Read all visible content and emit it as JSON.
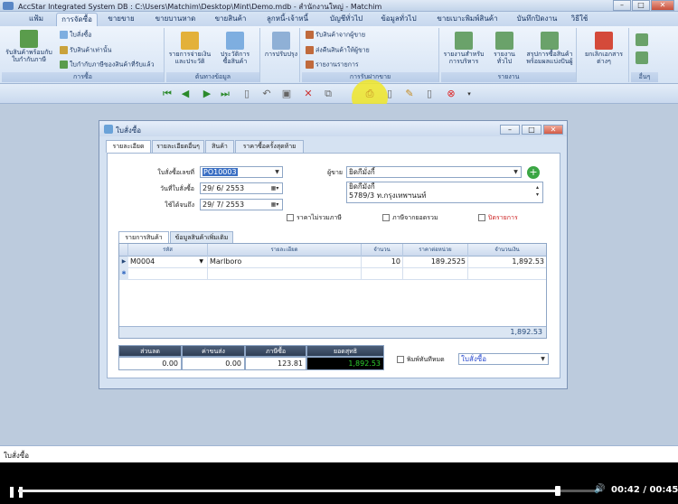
{
  "app": {
    "title": "AccStar Integrated System DB : C:\\Users\\Matchim\\Desktop\\Mint\\Demo.mdb - สำนักงานใหญ่ - Matchim"
  },
  "ribbon_tabs": [
    "แฟ้ม",
    "การจัดซื้อ",
    "ขายขาย",
    "ขายบานหาด",
    "ขายสินค้า",
    "ลูกหนี้-เจ้าหนี้",
    "บัญชีทั่วไป",
    "ข้อมูลทั่วไป",
    "ขายเบาะพิมพ์สินค้า",
    "บันทึกปิดงาน",
    "วิธีใช้"
  ],
  "active_tab_index": 1,
  "ribbon": {
    "groups": [
      {
        "label": "การซื้อ"
      },
      {
        "label": "ต้นทางข้อมูล"
      },
      {
        "label": ""
      },
      {
        "label": "การรับฝากขาย"
      },
      {
        "label": "รายงาน"
      },
      {
        "label": "อื่นๆ"
      }
    ],
    "buttons": {
      "receive_goods": "รับสินค้าพร้อมกับ\nใบกำกับภาษี",
      "purchase_order": "ใบสั่งซื้อ",
      "receive_goods_small": "รับสินค้าเท่านั้น",
      "tax_invoice": "ใบกำกับภาษีของสินค้าที่รับแล้ว",
      "po_report": "รายการจ่ายเงิน\nและประวัติ",
      "purchase_history": "ประวัติการ\nซื้อสินค้า",
      "adjust": "การปรับปรุง",
      "consign_receive": "รับสินค้าจากผู้ขาย",
      "consign_return": "ส่งคืนสินค้าให้ผู้ขาย",
      "consign_report": "รายงานรายการ",
      "report_1": "รายงานสำหรับ\nการบริหาร",
      "report_2": "รายงานทั่วไป",
      "report_3": "สรุปการซื้อสินค้า\nพร้อมผลแบ่งปันผู้",
      "cancel_doc": "ยกเลิกเอกสารต่างๆ"
    }
  },
  "child_window": {
    "title": "ใบสั่งซื้อ",
    "tabs": [
      "รายละเอียด",
      "รายละเอียดอื่นๆ",
      "สินค้า",
      "ราคาซื้อครั้งสุดท้าย"
    ],
    "active_tab_index": 0,
    "form": {
      "po_number_label": "ใบสั่งซื้อเลขที่",
      "po_number": "PO10003",
      "po_date_label": "วันที่ใบสั่งซื้อ",
      "po_date": "29/ 6/ 2553",
      "due_date_label": "ใช้ได้จนถึง",
      "due_date": "29/ 7/ 2553",
      "vendor_label": "ผู้ขาย",
      "vendor": "ยิดกีมั่งกี้",
      "vendor_address_line1": "ยิดกีมั่งกี้",
      "vendor_address_line2": "5789/3 ท.กรุงเทพฯนนท์",
      "checkbox_exclude_vat": "ราคาไม่รวมภาษี",
      "checkbox_no_discount": "ภาษีจากยอดรวม",
      "checkbox_cancelled": "ปิดรายการ"
    },
    "subtabs": [
      "รายการสินค้า",
      "ข้อมูลสินค้าเพิ่มเติม"
    ],
    "active_subtab_index": 0,
    "grid": {
      "columns": [
        "รหัส",
        "รายละเอียด",
        "จำนวน",
        "ราคาต่อหน่วย",
        "จำนวนเงิน"
      ],
      "rows": [
        {
          "code": "M0004",
          "description": "Marlboro",
          "qty": "10",
          "unit_price": "189.2525",
          "amount": "1,892.53"
        }
      ],
      "total": "1,892.53"
    },
    "totals": {
      "discount_label": "ส่วนลด",
      "discount": "0.00",
      "shipping_label": "ค่าขนส่ง",
      "shipping": "0.00",
      "vat_label": "ภาษีซื้อ",
      "vat": "123.81",
      "net_label": "ยอดสุทธิ",
      "net": "1,892.53"
    },
    "print_checkbox": "พิมพ์ทันทีหมด",
    "print_template": "ใบสั่งซื้อ"
  },
  "statusbar": {
    "text": "ใบสั่งซื้อ"
  },
  "player": {
    "time": "00:42 / 00:45",
    "progress": 0.933
  },
  "colors": {
    "highlight": "#f0e628",
    "net_total_bg": "#000000",
    "net_total_fg": "#2fd12f",
    "accent": "#15325f"
  }
}
